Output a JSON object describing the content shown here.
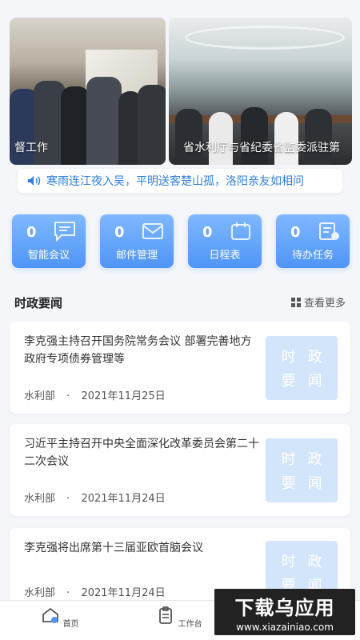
{
  "banner": {
    "slides": [
      {
        "caption": "督工作"
      },
      {
        "caption": "省水利厅与省纪委省监委派驻第"
      }
    ]
  },
  "notice": {
    "text": "寒雨连江夜入吴，平明送客楚山孤，洛阳亲友如相问"
  },
  "tiles": [
    {
      "count": "0",
      "label": "智能会议",
      "icon": "chat-icon"
    },
    {
      "count": "0",
      "label": "邮件管理",
      "icon": "mail-icon"
    },
    {
      "count": "0",
      "label": "日程表",
      "icon": "calendar-icon"
    },
    {
      "count": "0",
      "label": "待办任务",
      "icon": "task-icon"
    }
  ],
  "section": {
    "title": "时政要闻",
    "more": "查看更多"
  },
  "news": [
    {
      "title": "李克强主持召开国务院常务会议 部署完善地方政府专项债券管理等",
      "source": "水利部",
      "dot": "·",
      "date": "2021年11月25日",
      "thumb": [
        "时",
        "政",
        "要",
        "闻"
      ]
    },
    {
      "title": "习近平主持召开中央全面深化改革委员会第二十二次会议",
      "source": "水利部",
      "dot": "·",
      "date": "2021年11月24日",
      "thumb": [
        "时",
        "政",
        "要",
        "闻"
      ]
    },
    {
      "title": "李克强将出席第十三届亚欧首脑会议",
      "source": "水利部",
      "dot": "·",
      "date": "2021年11月24日",
      "thumb": [
        "时",
        "政",
        "要",
        "闻"
      ]
    }
  ],
  "nav": {
    "home": "首页",
    "workbench": "工作台"
  },
  "watermark": {
    "main": "下载乌应用",
    "sub": "www.xiazainiao.com"
  },
  "colors": {
    "accent": "#4f95f7",
    "notice_text": "#2f7de1",
    "thumb_bg": "#d3e5fb"
  }
}
